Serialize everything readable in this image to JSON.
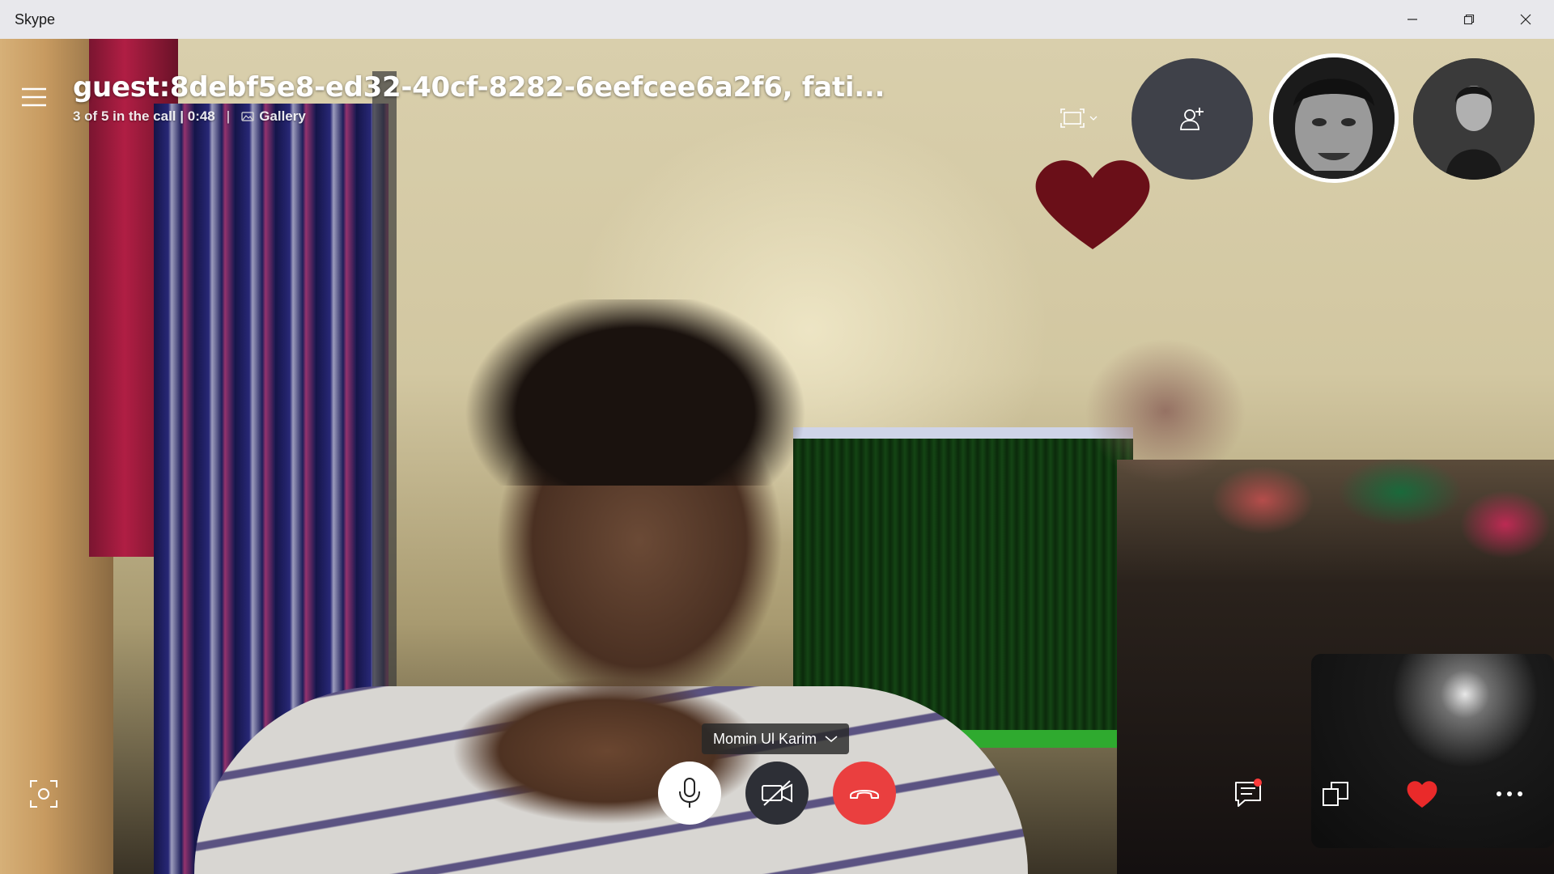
{
  "window": {
    "app_title": "Skype",
    "controls": [
      "minimize",
      "restore",
      "close"
    ]
  },
  "call": {
    "title": "guest:8debf5e8-ed32-40cf-8282-6eefcee6a2f6, fati...",
    "participants_status": "3 of 5 in the call | 0:48",
    "separator": "|",
    "view_mode_label": "Gallery"
  },
  "speaker": {
    "name": "Momin Ul Karim"
  },
  "icons": {
    "menu": "hamburger-icon",
    "gallery": "gallery-icon",
    "view_toggle": "fullscreen-view-icon",
    "add_people": "add-person-icon",
    "mic": "microphone-icon",
    "video": "video-off-icon",
    "hangup": "hang-up-icon",
    "snapshot": "snapshot-icon",
    "chat": "chat-icon",
    "share": "share-screen-icon",
    "react": "heart-icon",
    "more": "more-options-icon"
  },
  "colors": {
    "hangup": "#ea3f3f",
    "video_off_bg": "#2d2f36",
    "add_people_bg": "#3f4149",
    "react_heart": "#ea2a2a",
    "chat_notification": "#ff3b3b",
    "titlebar_bg": "#e8e8ec"
  }
}
